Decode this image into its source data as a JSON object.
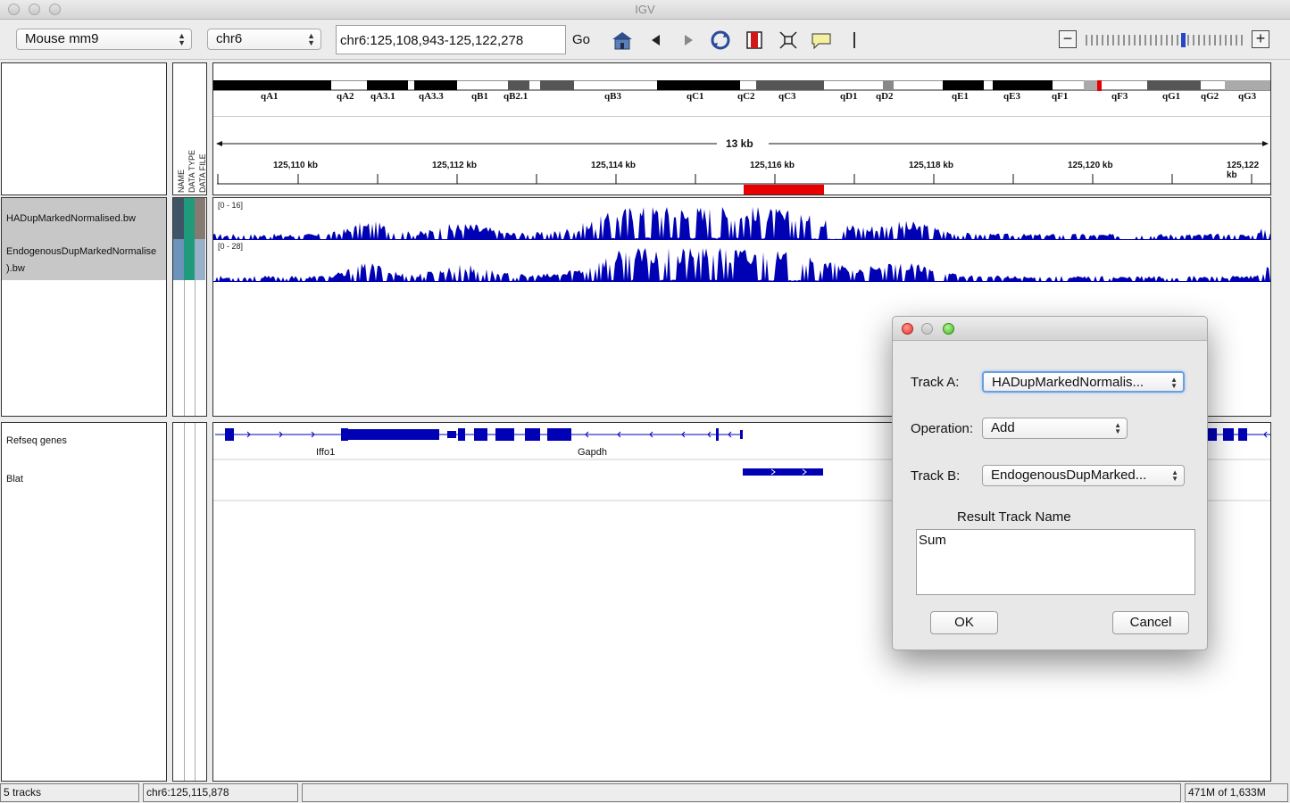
{
  "window": {
    "title": "IGV"
  },
  "toolbar": {
    "genome": "Mouse mm9",
    "chromosome": "chr6",
    "locus": "chr6:125,108,943-125,122,278",
    "go_label": "Go"
  },
  "ideogram": {
    "bands": [
      "qA1",
      "qA2",
      "qA3.1",
      "qA3.3",
      "qB1",
      "qB2.1",
      "qB3",
      "qC1",
      "qC2",
      "qC3",
      "qD1",
      "qD2",
      "qE1",
      "qE3",
      "qF1",
      "qF3",
      "qG1",
      "qG2",
      "qG3"
    ]
  },
  "ruler": {
    "span_label": "13 kb",
    "ticks": [
      "125,110 kb",
      "125,112 kb",
      "125,114 kb",
      "125,116 kb",
      "125,118 kb",
      "125,120 kb",
      "125,122 kb"
    ]
  },
  "attribute_headers": [
    "NAME",
    "DATA TYPE",
    "DATA FILE"
  ],
  "data_tracks": [
    {
      "name": "HADupMarkedNormalised.bw",
      "range": "[0 - 16]"
    },
    {
      "name": "EndogenousDupMarkedNormalised.bw",
      "name_line1": "EndogenousDupMarkedNormalise",
      "name_line2": ").bw",
      "range": "[0 - 28]"
    }
  ],
  "feature_tracks": [
    {
      "name": "Refseq genes"
    },
    {
      "name": "Blat"
    }
  ],
  "genes": [
    "Iffo1",
    "Gapdh"
  ],
  "colors": {
    "track_blue": "#0000b4",
    "region_red": "#e80000"
  },
  "status": {
    "tracks": "5 tracks",
    "position": "chr6:125,115,878",
    "message": "",
    "memory": "471M of 1,633M"
  },
  "dialog": {
    "track_a_label": "Track A:",
    "track_a_value": "HADupMarkedNormalis...",
    "operation_label": "Operation:",
    "operation_value": "Add",
    "track_b_label": "Track B:",
    "track_b_value": "EndogenousDupMarked...",
    "result_name_label": "Result Track Name",
    "result_name_value": "Sum",
    "ok_label": "OK",
    "cancel_label": "Cancel"
  }
}
